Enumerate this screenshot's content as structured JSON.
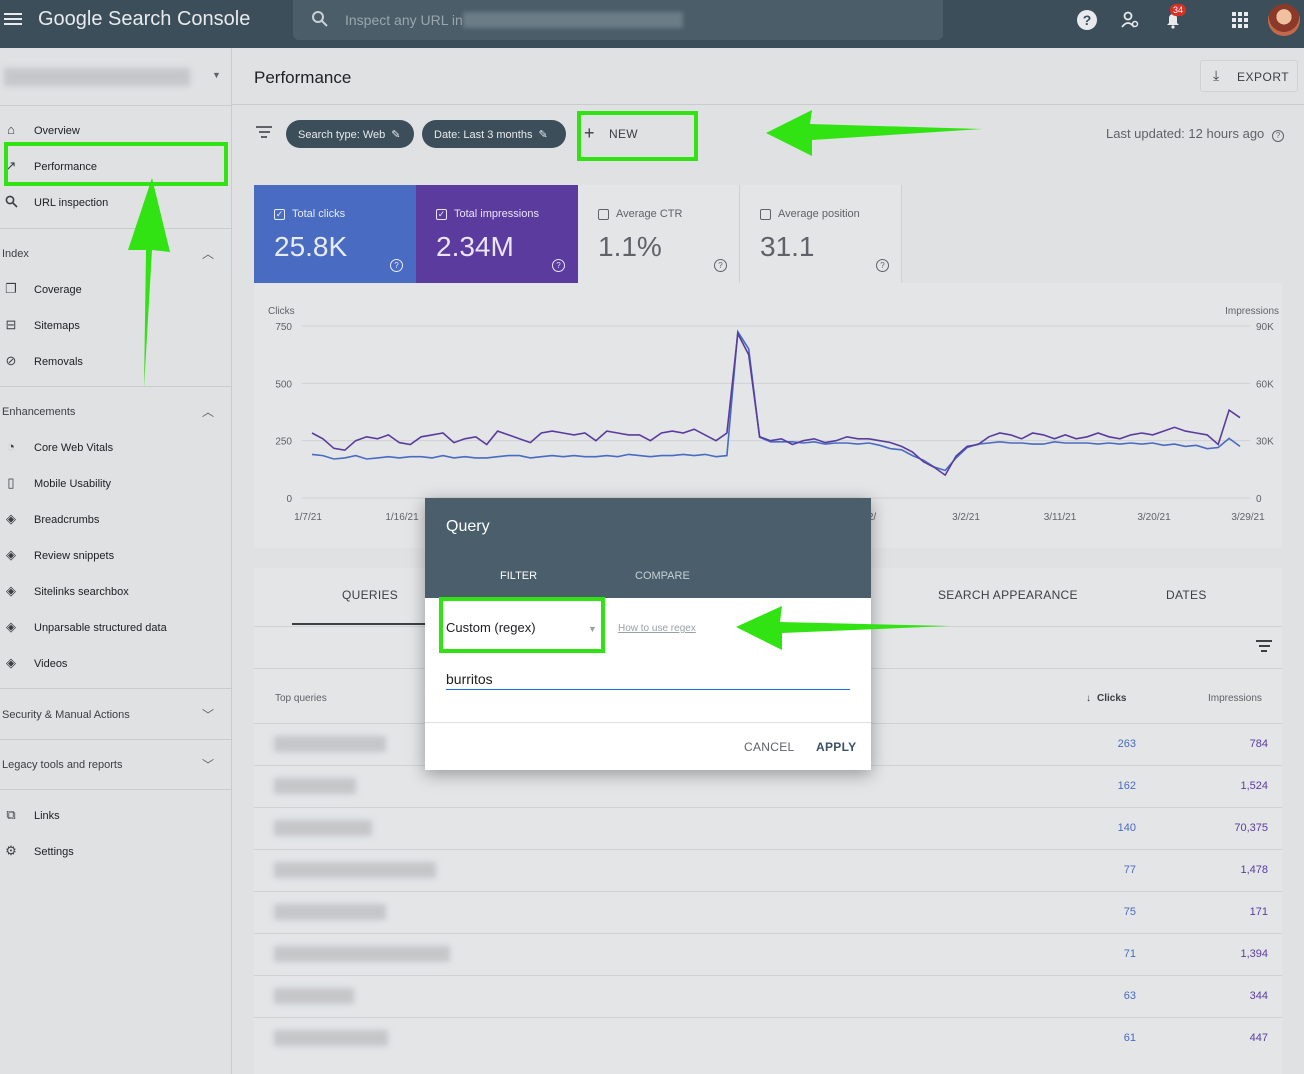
{
  "app": {
    "title": "Google Search Console",
    "search_placeholder": "Inspect any URL in",
    "notification_count": "34"
  },
  "sidebar": {
    "items_top": [
      {
        "label": "Overview",
        "icon": "home-icon"
      },
      {
        "label": "Performance",
        "icon": "trending-up-icon"
      },
      {
        "label": "URL inspection",
        "icon": "search-icon"
      }
    ],
    "index_section": "Index",
    "index_items": [
      {
        "label": "Coverage",
        "icon": "coverage-icon"
      },
      {
        "label": "Sitemaps",
        "icon": "sitemap-icon"
      },
      {
        "label": "Removals",
        "icon": "eye-off-icon"
      }
    ],
    "enhancements_section": "Enhancements",
    "enhancement_items": [
      {
        "label": "Core Web Vitals",
        "icon": "gauge-icon"
      },
      {
        "label": "Mobile Usability",
        "icon": "phone-icon"
      },
      {
        "label": "Breadcrumbs",
        "icon": "layers-icon"
      },
      {
        "label": "Review snippets",
        "icon": "layers-icon"
      },
      {
        "label": "Sitelinks searchbox",
        "icon": "layers-icon"
      },
      {
        "label": "Unparsable structured data",
        "icon": "layers-icon"
      },
      {
        "label": "Videos",
        "icon": "layers-icon"
      }
    ],
    "security_section": "Security & Manual Actions",
    "legacy_section": "Legacy tools and reports",
    "bottom_items": [
      {
        "label": "Links",
        "icon": "links-icon"
      },
      {
        "label": "Settings",
        "icon": "gear-icon"
      }
    ]
  },
  "page": {
    "title": "Performance",
    "export_label": "EXPORT",
    "filters": {
      "search_type": "Search type: Web",
      "date": "Date: Last 3 months",
      "new_label": "NEW"
    },
    "last_updated": "Last updated: 12 hours ago"
  },
  "metrics": [
    {
      "label": "Total clicks",
      "value": "25.8K",
      "checked": true
    },
    {
      "label": "Total impressions",
      "value": "2.34M",
      "checked": true
    },
    {
      "label": "Average CTR",
      "value": "1.1%",
      "checked": false
    },
    {
      "label": "Average position",
      "value": "31.1",
      "checked": false
    }
  ],
  "chart_data": {
    "type": "line",
    "left_axis_label": "Clicks",
    "right_axis_label": "Impressions",
    "left_ticks": [
      "0",
      "250",
      "500",
      "750"
    ],
    "right_ticks": [
      "0",
      "30K",
      "60K",
      "90K"
    ],
    "ylim_left": [
      0,
      750
    ],
    "ylim_right": [
      0,
      90000
    ],
    "x_tick_labels": [
      "1/7/21",
      "1/16/21",
      "2/",
      "3/2/21",
      "3/11/21",
      "3/20/21",
      "3/29/21"
    ],
    "series": [
      {
        "name": "Clicks",
        "color": "#4a6bc2",
        "values": [
          190,
          185,
          170,
          175,
          185,
          170,
          175,
          180,
          175,
          180,
          180,
          175,
          185,
          175,
          180,
          175,
          175,
          180,
          185,
          185,
          175,
          180,
          185,
          180,
          185,
          180,
          180,
          185,
          180,
          190,
          185,
          180,
          185,
          185,
          190,
          185,
          190,
          180,
          185,
          725,
          650,
          265,
          245,
          245,
          245,
          240,
          245,
          235,
          240,
          240,
          235,
          240,
          230,
          215,
          210,
          185,
          165,
          135,
          120,
          175,
          220,
          235,
          240,
          245,
          240,
          240,
          235,
          235,
          245,
          240,
          240,
          240,
          235,
          240,
          235,
          240,
          235,
          240,
          230,
          235,
          225,
          230,
          215,
          220,
          260,
          225
        ]
      },
      {
        "name": "Impressions",
        "color": "#5b3c9e",
        "values": [
          34000,
          31000,
          26000,
          25000,
          30000,
          32000,
          31000,
          33000,
          29000,
          28000,
          32000,
          33000,
          34000,
          29000,
          31000,
          32000,
          28000,
          35000,
          33000,
          31000,
          29000,
          34000,
          35000,
          34000,
          33000,
          34000,
          30000,
          35000,
          34000,
          33000,
          33000,
          30000,
          34000,
          35000,
          34000,
          36000,
          33000,
          30000,
          34000,
          86000,
          75000,
          32000,
          30000,
          31000,
          28000,
          30000,
          31000,
          29000,
          30000,
          32000,
          31000,
          31000,
          30000,
          29000,
          27000,
          24000,
          19000,
          16000,
          12000,
          22000,
          27000,
          28000,
          32000,
          34000,
          33000,
          31000,
          34000,
          33000,
          31000,
          33000,
          31000,
          32000,
          34000,
          32000,
          31000,
          33000,
          34000,
          33000,
          35000,
          37000,
          35000,
          34000,
          33000,
          28000,
          46000,
          42000
        ]
      }
    ]
  },
  "table": {
    "tabs": [
      "QUERIES",
      "SEARCH APPEARANCE",
      "DATES"
    ],
    "col_top_queries": "Top queries",
    "col_clicks": "Clicks",
    "col_impressions": "Impressions",
    "rows": [
      {
        "clicks": "263",
        "impressions": "784"
      },
      {
        "clicks": "162",
        "impressions": "1,524"
      },
      {
        "clicks": "140",
        "impressions": "70,375"
      },
      {
        "clicks": "77",
        "impressions": "1,478"
      },
      {
        "clicks": "75",
        "impressions": "171"
      },
      {
        "clicks": "71",
        "impressions": "1,394"
      },
      {
        "clicks": "63",
        "impressions": "344"
      },
      {
        "clicks": "61",
        "impressions": "447"
      }
    ]
  },
  "dialog": {
    "title": "Query",
    "tab_filter": "FILTER",
    "tab_compare": "COMPARE",
    "match_type": "Custom (regex)",
    "help_link": "How to use regex",
    "query_value": "burritos",
    "cancel_label": "CANCEL",
    "apply_label": "APPLY"
  },
  "annotation_color": "#31e312"
}
